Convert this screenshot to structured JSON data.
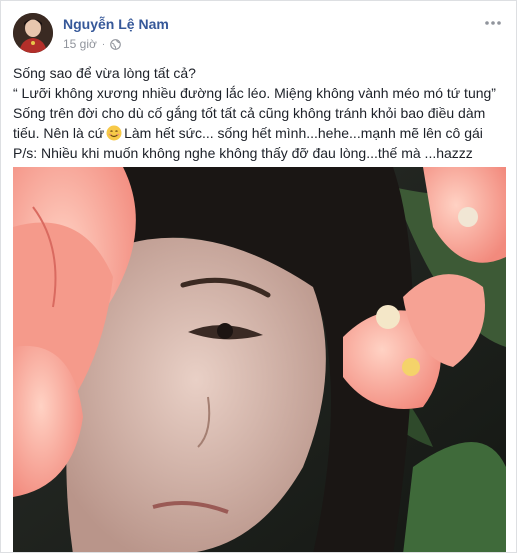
{
  "post": {
    "author": "Nguyễn Lệ Nam",
    "timestamp": "15 giờ",
    "privacy_icon": "globe-icon",
    "more_icon": "more-options-icon",
    "lines": [
      "Sống sao để vừa lòng tất cả?",
      "“ Lưỡi không xương nhiều đường lắc léo. Miệng không vành méo mó tứ tung”",
      "Sống trên đời cho dù cố gắng tốt tất cả cũng không tránh khỏi bao điều dàm",
      "tiếu. Nên là cứ",
      "Làm hết sức... sống hết mình...hehe...mạnh mẽ lên cô gái",
      "P/s: Nhiều khi muốn không nghe không thấy đỡ đau lòng...thế mà ...hazzz"
    ],
    "emoji_icon": "smiling-face-emoji"
  },
  "colors": {
    "author_blue": "#365899",
    "meta_gray": "#90949c",
    "text": "#1d2129"
  }
}
